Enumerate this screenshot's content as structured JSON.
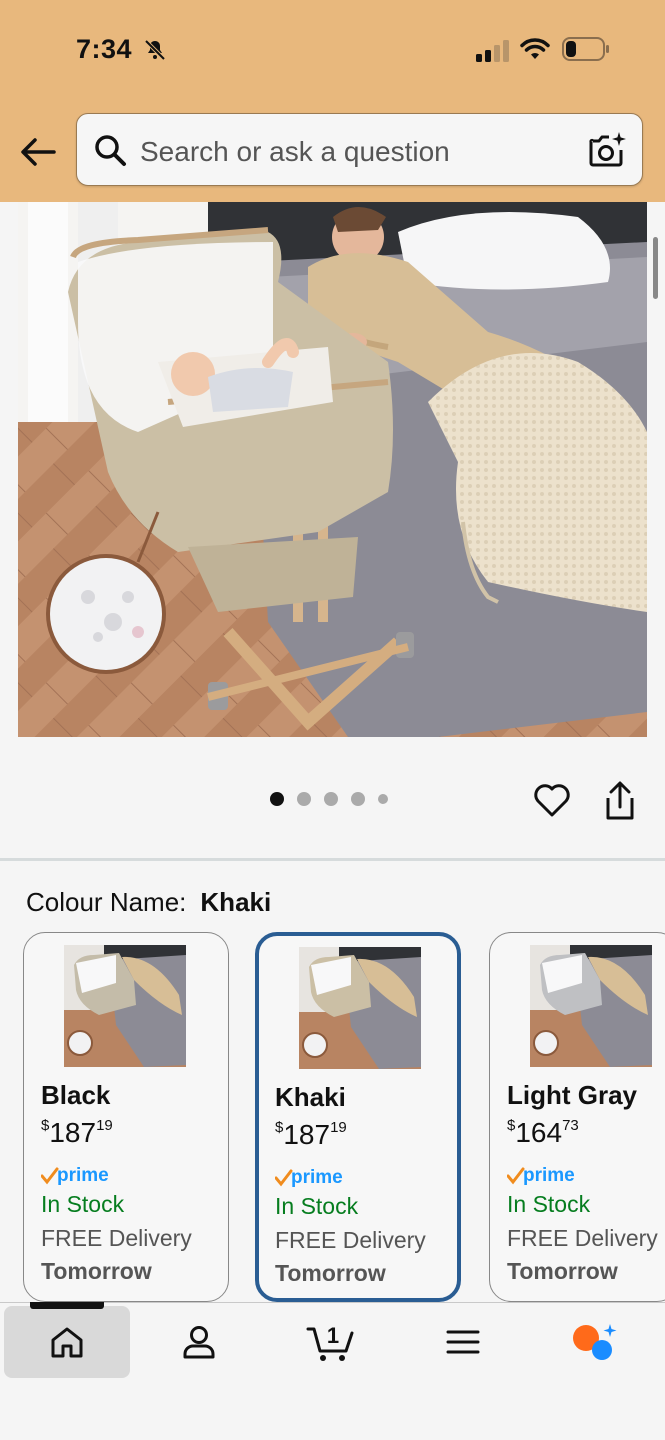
{
  "status_bar": {
    "time": "7:34"
  },
  "search": {
    "placeholder": "Search or ask a question"
  },
  "gallery": {
    "image_count": 5,
    "active_index": 0
  },
  "variation": {
    "label": "Colour Name:",
    "selected": "Khaki"
  },
  "options": [
    {
      "name": "Black",
      "price_symbol": "$",
      "price_whole": "187",
      "price_fraction": "19",
      "prime": "prime",
      "stock": "In Stock",
      "delivery": "FREE Delivery",
      "delivery_day": "Tomorrow"
    },
    {
      "name": "Khaki",
      "price_symbol": "$",
      "price_whole": "187",
      "price_fraction": "19",
      "prime": "prime",
      "stock": "In Stock",
      "delivery": "FREE Delivery",
      "delivery_day": "Tomorrow"
    },
    {
      "name": "Light Gray",
      "price_symbol": "$",
      "price_whole": "164",
      "price_fraction": "73",
      "prime": "prime",
      "stock": "In Stock",
      "delivery": "FREE Delivery",
      "delivery_day": "Tomorrow"
    }
  ],
  "bottom_nav": {
    "cart_count": "1",
    "items": [
      "home-icon",
      "account-icon",
      "cart-icon",
      "menu-icon",
      "rufus-icon"
    ]
  },
  "colors": {
    "header": "#e8b87d",
    "in_stock": "#067d1f",
    "selected_border": "#2a5d93",
    "prime": "#1a98ff"
  }
}
